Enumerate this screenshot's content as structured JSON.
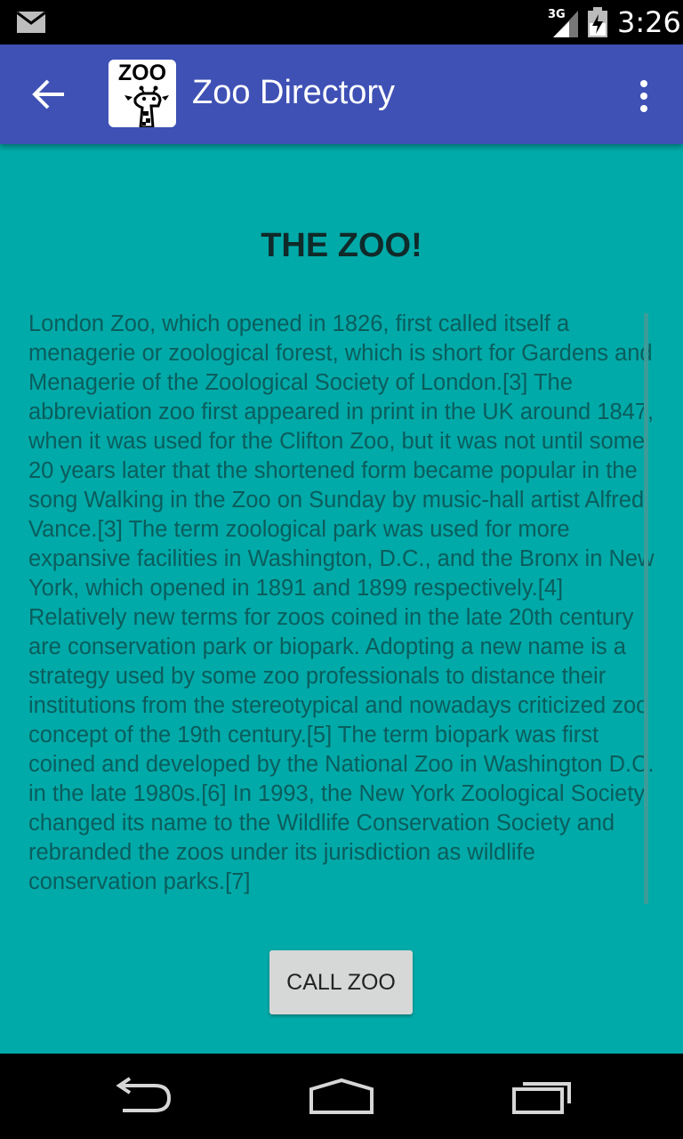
{
  "status_bar": {
    "network_type": "3G",
    "time": "3:26",
    "icons": [
      "mail-icon",
      "signal-icon",
      "battery-icon"
    ]
  },
  "app_bar": {
    "title": "Zoo Directory",
    "logo_text": "ZOO",
    "color": "#3f51b5",
    "icons": [
      "back-arrow-icon",
      "overflow-menu-icon"
    ]
  },
  "content": {
    "background_color": "#00aaa8",
    "heading": "THE ZOO!",
    "body": "London Zoo, which opened in 1826, first called itself a menagerie or zoological forest, which is short for Gardens and Menagerie of the Zoological Society of London.[3] The abbreviation zoo first appeared in print in the UK around 1847, when it was used for the Clifton Zoo, but it was not until some 20 years later that the shortened form became popular in the song Walking in the Zoo on Sunday by music-hall artist Alfred Vance.[3] The term zoological park was used for more expansive facilities in Washington, D.C., and the Bronx in New York, which opened in 1891 and 1899 respectively.[4] Relatively new terms for zoos coined in the late 20th century are conservation park or biopark. Adopting a new name is a strategy used by some zoo professionals to distance their institutions from the stereotypical and nowadays criticized zoo concept of the 19th century.[5] The term biopark was first coined and developed by the National Zoo in Washington D.C. in the late 1980s.[6] In 1993, the New York Zoological Society changed its name to the Wildlife Conservation Society and rebranded the zoos under its jurisdiction as wildlife conservation parks.[7]",
    "call_button_label": "CALL ZOO"
  },
  "nav_bar": {
    "icons": [
      "back-nav-icon",
      "home-nav-icon",
      "recents-nav-icon"
    ]
  }
}
